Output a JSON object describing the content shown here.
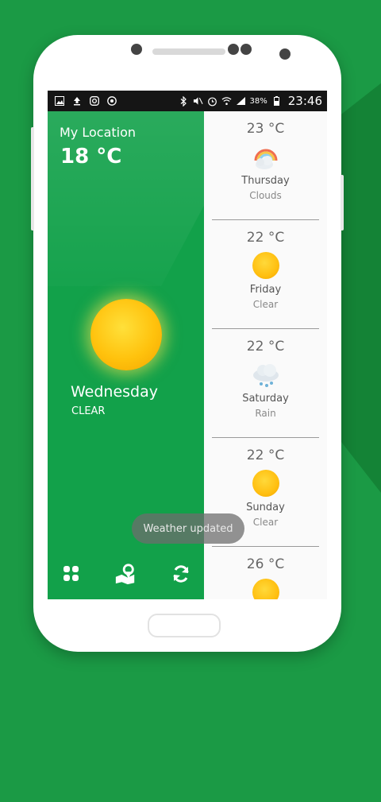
{
  "status_bar": {
    "left_icons": [
      "image-icon",
      "upload-icon",
      "instagram-icon",
      "chrome-icon"
    ],
    "right_icons": [
      "bluetooth-icon",
      "mute-icon",
      "alarm-icon",
      "wifi-icon",
      "signal-icon"
    ],
    "battery": "38%",
    "time": "23:46"
  },
  "current": {
    "location_label": "My Location",
    "temperature": "18 °C",
    "day": "Wednesday",
    "condition": "CLEAR",
    "icon": "sun-icon"
  },
  "forecast": [
    {
      "temp": "23 °C",
      "day": "Thursday",
      "condition": "Clouds",
      "icon": "cloud-rainbow-icon"
    },
    {
      "temp": "22 °C",
      "day": "Friday",
      "condition": "Clear",
      "icon": "sun-icon"
    },
    {
      "temp": "22 °C",
      "day": "Saturday",
      "condition": "Rain",
      "icon": "cloud-rain-icon"
    },
    {
      "temp": "22 °C",
      "day": "Sunday",
      "condition": "Clear",
      "icon": "sun-icon"
    },
    {
      "temp": "26 °C",
      "day": "",
      "condition": "",
      "icon": "sun-icon"
    }
  ],
  "bottom_nav": [
    "widgets-icon",
    "map-location-icon",
    "refresh-icon"
  ],
  "toast": "Weather updated",
  "colors": {
    "accent": "#12a14a",
    "background": "#1b9a45"
  }
}
